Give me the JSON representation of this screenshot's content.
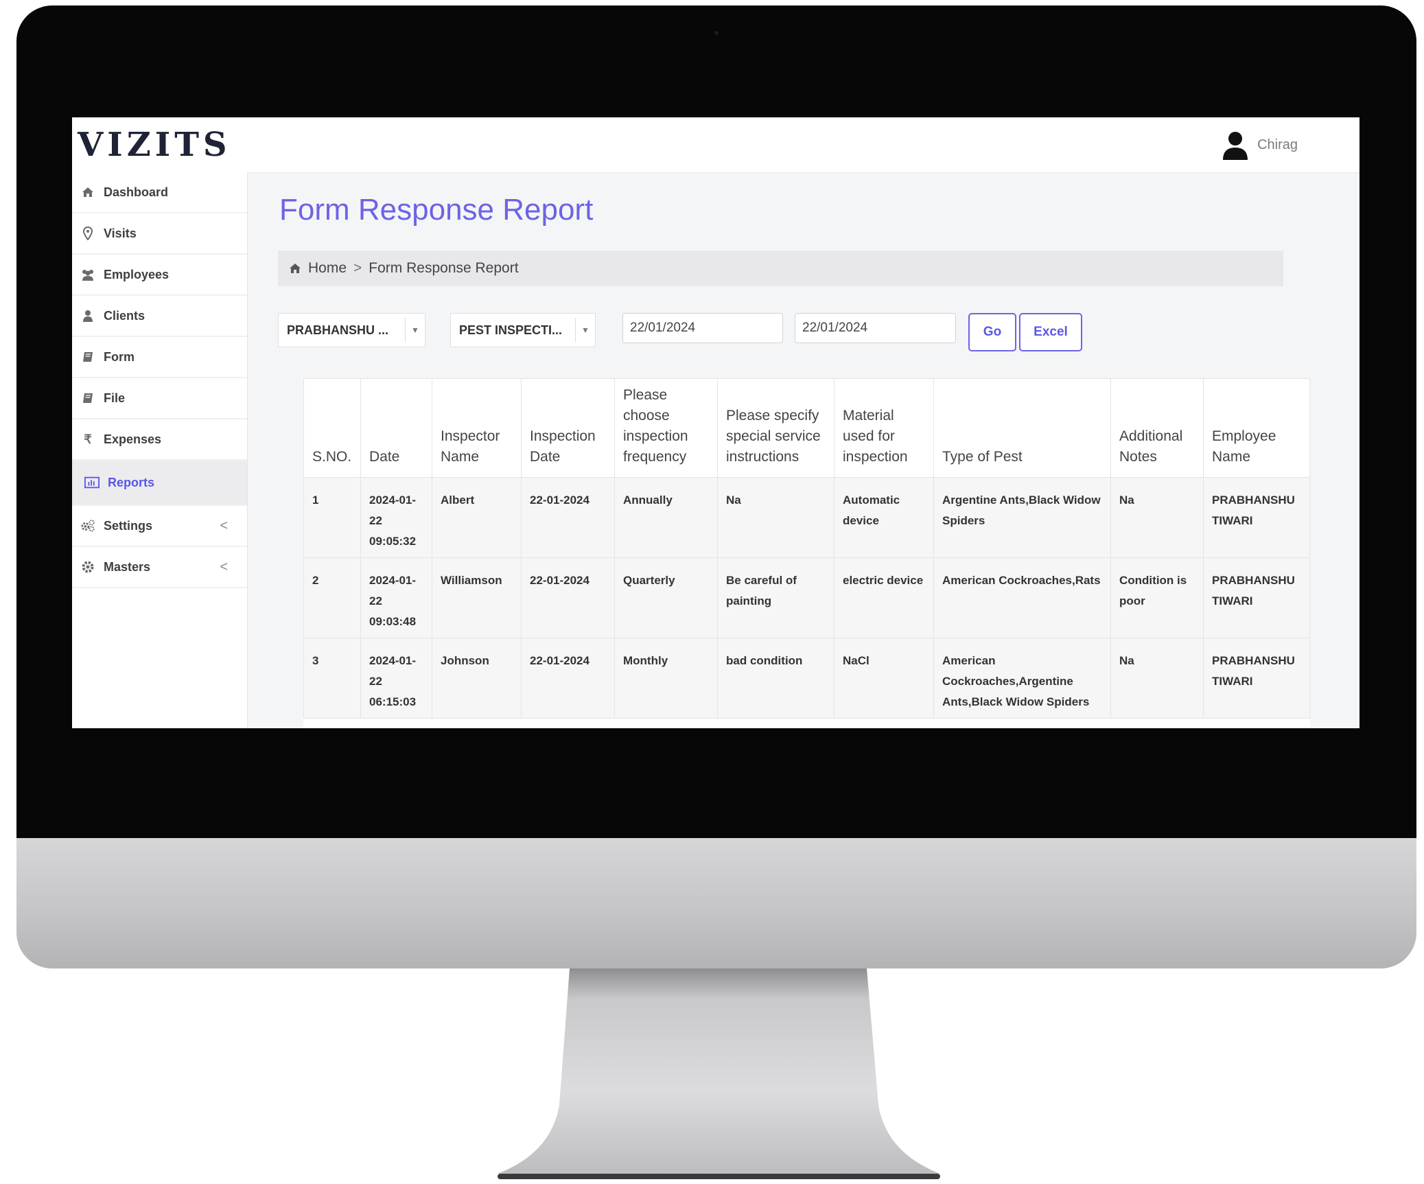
{
  "app": {
    "logo_text": "VIZITS",
    "user_name": "Chirag"
  },
  "sidebar": {
    "items": [
      {
        "label": "Dashboard",
        "icon": "home-icon"
      },
      {
        "label": "Visits",
        "icon": "map-pin-icon"
      },
      {
        "label": "Employees",
        "icon": "users-icon"
      },
      {
        "label": "Clients",
        "icon": "user-icon"
      },
      {
        "label": "Form",
        "icon": "book-icon"
      },
      {
        "label": "File",
        "icon": "book-icon"
      },
      {
        "label": "Expenses",
        "icon": "rupee-icon"
      },
      {
        "label": "Reports",
        "icon": "bar-chart-icon",
        "active": true
      },
      {
        "label": "Settings",
        "icon": "gears-icon",
        "chevron": "<"
      },
      {
        "label": "Masters",
        "icon": "gear-icon",
        "chevron": "<"
      }
    ]
  },
  "page": {
    "title": "Form Response Report",
    "breadcrumb": {
      "home": "Home",
      "separator": ">",
      "current": "Form Response Report"
    }
  },
  "filters": {
    "employee_select": "PRABHANSHU ...",
    "form_select": "PEST INSPECTI...",
    "from_date": "22/01/2024",
    "to_date": "22/01/2024",
    "go_label": "Go",
    "excel_label": "Excel"
  },
  "table": {
    "headers": [
      "S.NO.",
      "Date",
      "Inspector Name",
      "Inspection Date",
      "Please choose inspection frequency",
      "Please specify special service instructions",
      "Material used for inspection",
      "Type of Pest",
      "Additional Notes",
      "Employee Name"
    ],
    "rows": [
      [
        "1",
        "2024-01-22 09:05:32",
        "Albert",
        "22-01-2024",
        "Annually",
        "Na",
        "Automatic device",
        "Argentine Ants,Black Widow Spiders",
        "Na",
        "PRABHANSHU TIWARI"
      ],
      [
        "2",
        "2024-01-22 09:03:48",
        "Williamson",
        "22-01-2024",
        "Quarterly",
        "Be careful of painting",
        "electric device",
        "American Cockroaches,Rats",
        "Condition is poor",
        "PRABHANSHU TIWARI"
      ],
      [
        "3",
        "2024-01-22 06:15:03",
        "Johnson",
        "22-01-2024",
        "Monthly",
        "bad condition",
        "NaCl",
        "American Cockroaches,Argentine Ants,Black Widow Spiders",
        "Na",
        "PRABHANSHU TIWARI"
      ]
    ]
  },
  "colors": {
    "accent": "#6c63e6",
    "bezel": "#070707",
    "chin": "#c4c4c6"
  }
}
